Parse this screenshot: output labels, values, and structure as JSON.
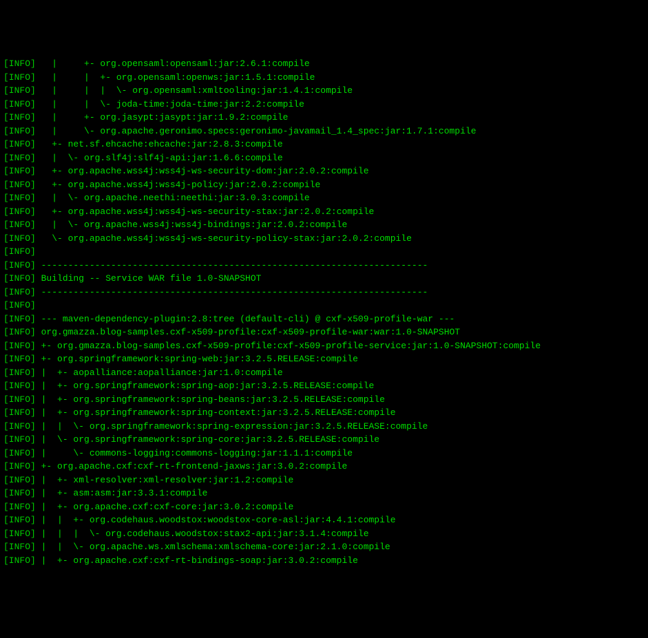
{
  "prefix": "[INFO]",
  "lines": [
    "   |     +- org.opensaml:opensaml:jar:2.6.1:compile",
    "   |     |  +- org.opensaml:openws:jar:1.5.1:compile",
    "   |     |  |  \\- org.opensaml:xmltooling:jar:1.4.1:compile",
    "   |     |  \\- joda-time:joda-time:jar:2.2:compile",
    "   |     +- org.jasypt:jasypt:jar:1.9.2:compile",
    "   |     \\- org.apache.geronimo.specs:geronimo-javamail_1.4_spec:jar:1.7.1:compile",
    "   +- net.sf.ehcache:ehcache:jar:2.8.3:compile",
    "   |  \\- org.slf4j:slf4j-api:jar:1.6.6:compile",
    "   +- org.apache.wss4j:wss4j-ws-security-dom:jar:2.0.2:compile",
    "   +- org.apache.wss4j:wss4j-policy:jar:2.0.2:compile",
    "   |  \\- org.apache.neethi:neethi:jar:3.0.3:compile",
    "   +- org.apache.wss4j:wss4j-ws-security-stax:jar:2.0.2:compile",
    "   |  \\- org.apache.wss4j:wss4j-bindings:jar:2.0.2:compile",
    "   \\- org.apache.wss4j:wss4j-ws-security-policy-stax:jar:2.0.2:compile",
    "                                                                         ",
    " ------------------------------------------------------------------------",
    " Building -- Service WAR file 1.0-SNAPSHOT",
    " ------------------------------------------------------------------------",
    "                                                                         ",
    " --- maven-dependency-plugin:2.8:tree (default-cli) @ cxf-x509-profile-war ---",
    " org.gmazza.blog-samples.cxf-x509-profile:cxf-x509-profile-war:war:1.0-SNAPSHOT",
    " +- org.gmazza.blog-samples.cxf-x509-profile:cxf-x509-profile-service:jar:1.0-SNAPSHOT:compile",
    " +- org.springframework:spring-web:jar:3.2.5.RELEASE:compile",
    " |  +- aopalliance:aopalliance:jar:1.0:compile",
    " |  +- org.springframework:spring-aop:jar:3.2.5.RELEASE:compile",
    " |  +- org.springframework:spring-beans:jar:3.2.5.RELEASE:compile",
    " |  +- org.springframework:spring-context:jar:3.2.5.RELEASE:compile",
    " |  |  \\- org.springframework:spring-expression:jar:3.2.5.RELEASE:compile",
    " |  \\- org.springframework:spring-core:jar:3.2.5.RELEASE:compile",
    " |     \\- commons-logging:commons-logging:jar:1.1.1:compile",
    " +- org.apache.cxf:cxf-rt-frontend-jaxws:jar:3.0.2:compile",
    " |  +- xml-resolver:xml-resolver:jar:1.2:compile",
    " |  +- asm:asm:jar:3.3.1:compile",
    " |  +- org.apache.cxf:cxf-core:jar:3.0.2:compile",
    " |  |  +- org.codehaus.woodstox:woodstox-core-asl:jar:4.4.1:compile",
    " |  |  |  \\- org.codehaus.woodstox:stax2-api:jar:3.1.4:compile",
    " |  |  \\- org.apache.ws.xmlschema:xmlschema-core:jar:2.1.0:compile",
    " |  +- org.apache.cxf:cxf-rt-bindings-soap:jar:3.0.2:compile"
  ]
}
